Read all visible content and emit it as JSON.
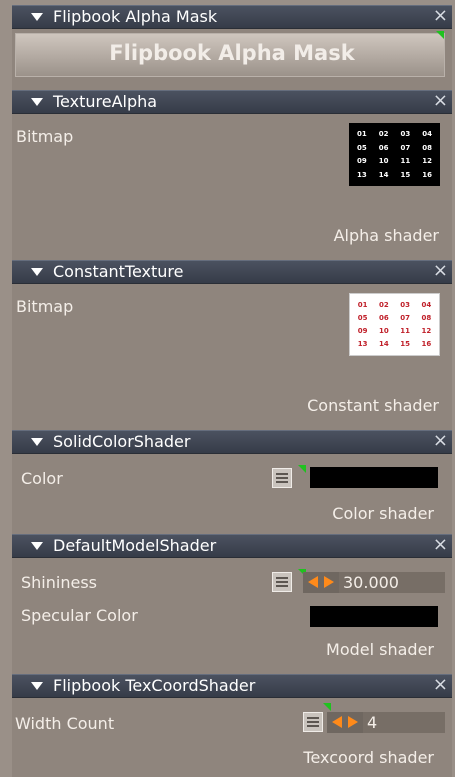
{
  "sections": [
    {
      "title": "Flipbook Alpha Mask",
      "banner": "Flipbook Alpha Mask"
    },
    {
      "title": "TextureAlpha",
      "label": "Bitmap",
      "footer": "Alpha shader",
      "thumb": [
        "01",
        "02",
        "03",
        "04",
        "05",
        "06",
        "07",
        "08",
        "09",
        "10",
        "11",
        "12",
        "13",
        "14",
        "15",
        "16"
      ]
    },
    {
      "title": "ConstantTexture",
      "label": "Bitmap",
      "footer": "Constant shader",
      "thumb": [
        "01",
        "02",
        "03",
        "04",
        "05",
        "06",
        "07",
        "08",
        "09",
        "10",
        "11",
        "12",
        "13",
        "14",
        "15",
        "16"
      ]
    },
    {
      "title": "SolidColorShader",
      "label": "Color",
      "footer": "Color shader",
      "color": "#000000"
    },
    {
      "title": "DefaultModelShader",
      "label": "Shininess",
      "value": "30.000",
      "label2": "Specular Color",
      "footer": "Model shader",
      "color": "#000000"
    },
    {
      "title": "Flipbook TexCoordShader",
      "label": "Width Count",
      "value": "4",
      "footer": "Texcoord shader"
    }
  ],
  "close_glyph": "×",
  "colors": {
    "header": "#3f4654",
    "panel": "#8f857d",
    "accent": "#ff8a1a",
    "corner": "#1fc21f"
  }
}
